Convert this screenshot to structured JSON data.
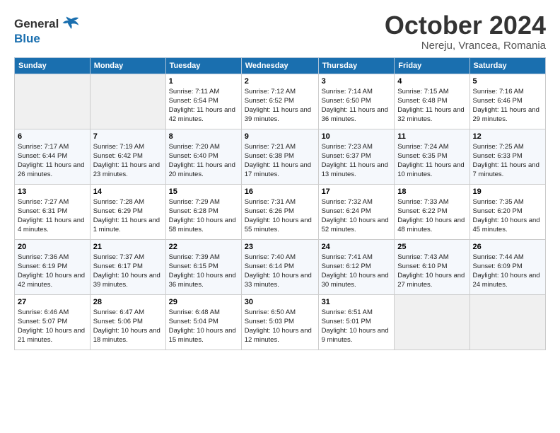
{
  "header": {
    "logo_line1": "General",
    "logo_line2": "Blue",
    "month": "October 2024",
    "location": "Nereju, Vrancea, Romania"
  },
  "weekdays": [
    "Sunday",
    "Monday",
    "Tuesday",
    "Wednesday",
    "Thursday",
    "Friday",
    "Saturday"
  ],
  "weeks": [
    [
      {
        "day": "",
        "info": ""
      },
      {
        "day": "",
        "info": ""
      },
      {
        "day": "1",
        "info": "Sunrise: 7:11 AM\nSunset: 6:54 PM\nDaylight: 11 hours and 42 minutes."
      },
      {
        "day": "2",
        "info": "Sunrise: 7:12 AM\nSunset: 6:52 PM\nDaylight: 11 hours and 39 minutes."
      },
      {
        "day": "3",
        "info": "Sunrise: 7:14 AM\nSunset: 6:50 PM\nDaylight: 11 hours and 36 minutes."
      },
      {
        "day": "4",
        "info": "Sunrise: 7:15 AM\nSunset: 6:48 PM\nDaylight: 11 hours and 32 minutes."
      },
      {
        "day": "5",
        "info": "Sunrise: 7:16 AM\nSunset: 6:46 PM\nDaylight: 11 hours and 29 minutes."
      }
    ],
    [
      {
        "day": "6",
        "info": "Sunrise: 7:17 AM\nSunset: 6:44 PM\nDaylight: 11 hours and 26 minutes."
      },
      {
        "day": "7",
        "info": "Sunrise: 7:19 AM\nSunset: 6:42 PM\nDaylight: 11 hours and 23 minutes."
      },
      {
        "day": "8",
        "info": "Sunrise: 7:20 AM\nSunset: 6:40 PM\nDaylight: 11 hours and 20 minutes."
      },
      {
        "day": "9",
        "info": "Sunrise: 7:21 AM\nSunset: 6:38 PM\nDaylight: 11 hours and 17 minutes."
      },
      {
        "day": "10",
        "info": "Sunrise: 7:23 AM\nSunset: 6:37 PM\nDaylight: 11 hours and 13 minutes."
      },
      {
        "day": "11",
        "info": "Sunrise: 7:24 AM\nSunset: 6:35 PM\nDaylight: 11 hours and 10 minutes."
      },
      {
        "day": "12",
        "info": "Sunrise: 7:25 AM\nSunset: 6:33 PM\nDaylight: 11 hours and 7 minutes."
      }
    ],
    [
      {
        "day": "13",
        "info": "Sunrise: 7:27 AM\nSunset: 6:31 PM\nDaylight: 11 hours and 4 minutes."
      },
      {
        "day": "14",
        "info": "Sunrise: 7:28 AM\nSunset: 6:29 PM\nDaylight: 11 hours and 1 minute."
      },
      {
        "day": "15",
        "info": "Sunrise: 7:29 AM\nSunset: 6:28 PM\nDaylight: 10 hours and 58 minutes."
      },
      {
        "day": "16",
        "info": "Sunrise: 7:31 AM\nSunset: 6:26 PM\nDaylight: 10 hours and 55 minutes."
      },
      {
        "day": "17",
        "info": "Sunrise: 7:32 AM\nSunset: 6:24 PM\nDaylight: 10 hours and 52 minutes."
      },
      {
        "day": "18",
        "info": "Sunrise: 7:33 AM\nSunset: 6:22 PM\nDaylight: 10 hours and 48 minutes."
      },
      {
        "day": "19",
        "info": "Sunrise: 7:35 AM\nSunset: 6:20 PM\nDaylight: 10 hours and 45 minutes."
      }
    ],
    [
      {
        "day": "20",
        "info": "Sunrise: 7:36 AM\nSunset: 6:19 PM\nDaylight: 10 hours and 42 minutes."
      },
      {
        "day": "21",
        "info": "Sunrise: 7:37 AM\nSunset: 6:17 PM\nDaylight: 10 hours and 39 minutes."
      },
      {
        "day": "22",
        "info": "Sunrise: 7:39 AM\nSunset: 6:15 PM\nDaylight: 10 hours and 36 minutes."
      },
      {
        "day": "23",
        "info": "Sunrise: 7:40 AM\nSunset: 6:14 PM\nDaylight: 10 hours and 33 minutes."
      },
      {
        "day": "24",
        "info": "Sunrise: 7:41 AM\nSunset: 6:12 PM\nDaylight: 10 hours and 30 minutes."
      },
      {
        "day": "25",
        "info": "Sunrise: 7:43 AM\nSunset: 6:10 PM\nDaylight: 10 hours and 27 minutes."
      },
      {
        "day": "26",
        "info": "Sunrise: 7:44 AM\nSunset: 6:09 PM\nDaylight: 10 hours and 24 minutes."
      }
    ],
    [
      {
        "day": "27",
        "info": "Sunrise: 6:46 AM\nSunset: 5:07 PM\nDaylight: 10 hours and 21 minutes."
      },
      {
        "day": "28",
        "info": "Sunrise: 6:47 AM\nSunset: 5:06 PM\nDaylight: 10 hours and 18 minutes."
      },
      {
        "day": "29",
        "info": "Sunrise: 6:48 AM\nSunset: 5:04 PM\nDaylight: 10 hours and 15 minutes."
      },
      {
        "day": "30",
        "info": "Sunrise: 6:50 AM\nSunset: 5:03 PM\nDaylight: 10 hours and 12 minutes."
      },
      {
        "day": "31",
        "info": "Sunrise: 6:51 AM\nSunset: 5:01 PM\nDaylight: 10 hours and 9 minutes."
      },
      {
        "day": "",
        "info": ""
      },
      {
        "day": "",
        "info": ""
      }
    ]
  ]
}
